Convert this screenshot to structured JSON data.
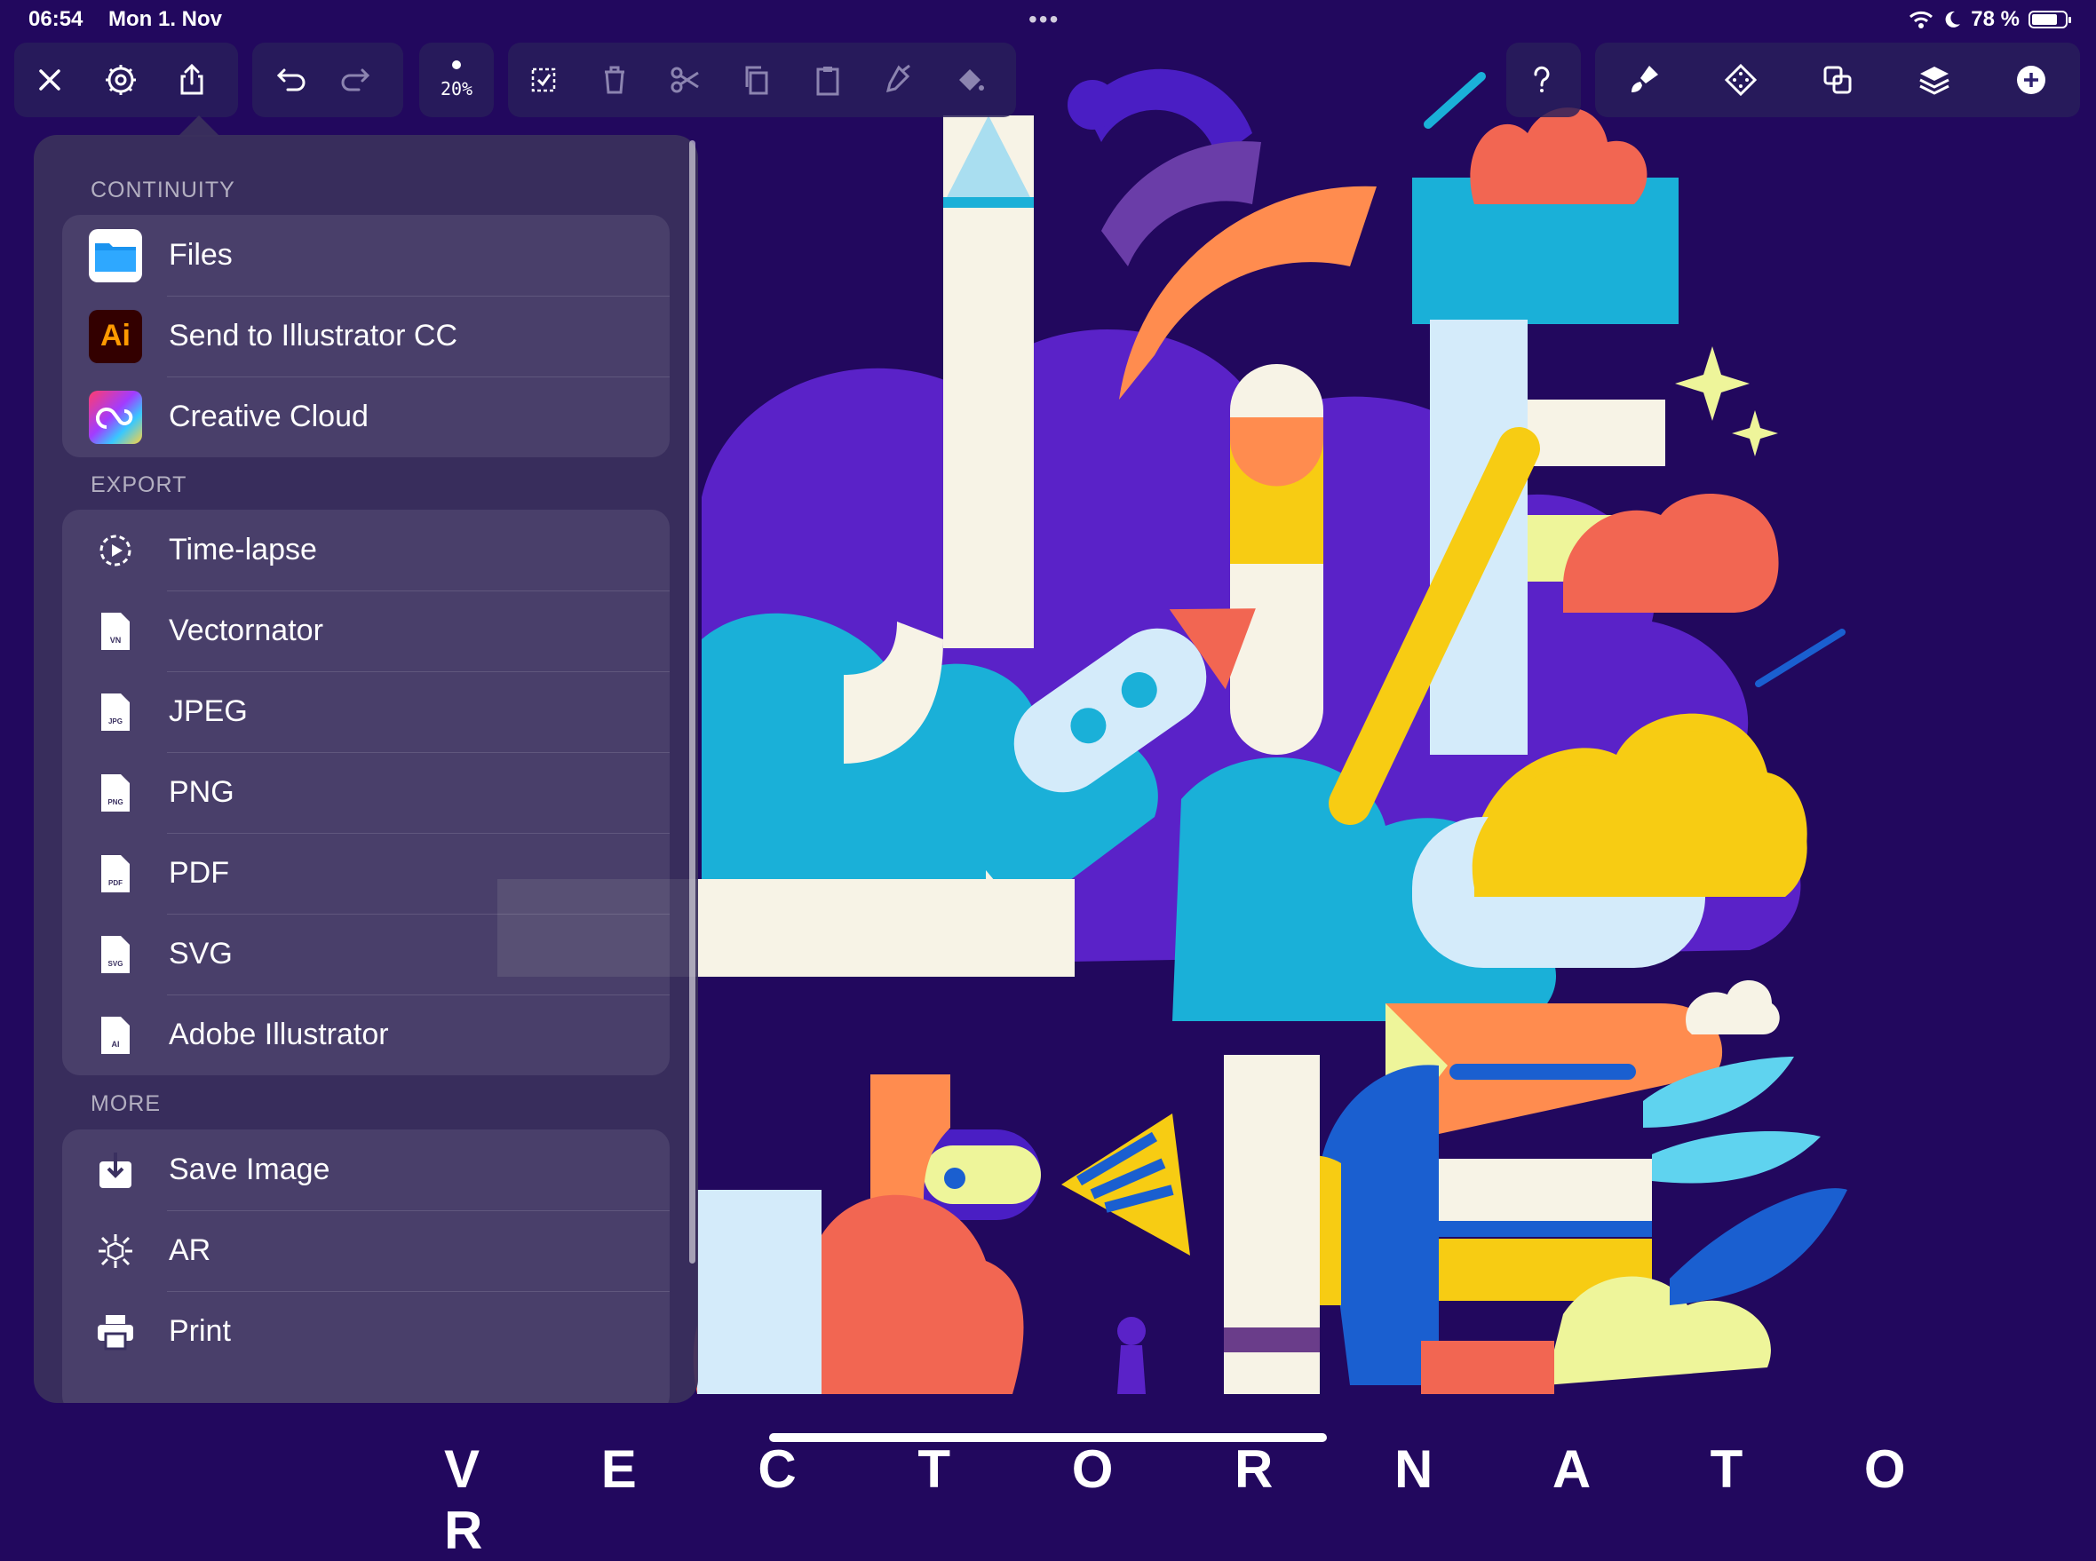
{
  "status": {
    "time": "06:54",
    "date": "Mon 1. Nov",
    "battery": "78 %",
    "battery_level": 0.78,
    "menu_dots": "•••"
  },
  "toolbar": {
    "zoom": "20%"
  },
  "menu": {
    "sections": [
      {
        "title": "CONTINUITY",
        "items": [
          {
            "label": "Files",
            "icon": "files-folder-icon"
          },
          {
            "label": "Send to Illustrator CC",
            "icon": "illustrator-icon"
          },
          {
            "label": "Creative Cloud",
            "icon": "creative-cloud-icon"
          }
        ]
      },
      {
        "title": "EXPORT",
        "items": [
          {
            "label": "Time-lapse",
            "icon": "timelapse-icon"
          },
          {
            "label": "Vectornator",
            "icon": "file-vn-icon",
            "tag": "VN"
          },
          {
            "label": "JPEG",
            "icon": "file-jpg-icon",
            "tag": "JPG"
          },
          {
            "label": "PNG",
            "icon": "file-png-icon",
            "tag": "PNG"
          },
          {
            "label": "PDF",
            "icon": "file-pdf-icon",
            "tag": "PDF"
          },
          {
            "label": "SVG",
            "icon": "file-svg-icon",
            "tag": "SVG"
          },
          {
            "label": "Adobe Illustrator",
            "icon": "file-ai-icon",
            "tag": "AI"
          }
        ]
      },
      {
        "title": "MORE",
        "items": [
          {
            "label": "Save Image",
            "icon": "save-image-icon"
          },
          {
            "label": "AR",
            "icon": "ar-icon"
          },
          {
            "label": "Print",
            "icon": "print-icon"
          }
        ]
      }
    ],
    "illustrator_badge": "Ai"
  },
  "canvas_text": "V E C T O R N A T O R",
  "colors": {
    "background": "#22085e",
    "accent_yellow": "#f7cc13",
    "accent_blue": "#1ab0d8",
    "accent_coral": "#f26652"
  }
}
